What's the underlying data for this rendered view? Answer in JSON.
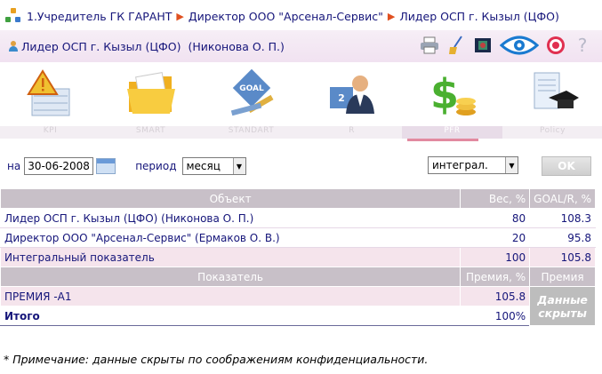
{
  "breadcrumb": {
    "items": [
      "1.Учредитель ГК ГАРАНТ",
      "Директор ООО \"Арсенал-Сервис\"",
      "Лидер ОСП г. Кызыл (ЦФО)"
    ]
  },
  "user": {
    "label": "Лидер ОСП г. Кызыл (ЦФО)  (Никонова О. П.)"
  },
  "toolbar": {
    "icons": [
      "printer-icon",
      "broom-icon",
      "film-icon",
      "eye-icon",
      "target-icon",
      "help-icon"
    ],
    "help_label": "?"
  },
  "modules": [
    {
      "icon": "kpi-warning-icon",
      "label": "KPI"
    },
    {
      "icon": "folder-icon",
      "label": "SMART"
    },
    {
      "icon": "goal-diamond-icon",
      "label": "STANDART"
    },
    {
      "icon": "user-card-icon",
      "label": "R"
    },
    {
      "icon": "dollar-coins-icon",
      "label": "PFR"
    },
    {
      "icon": "scroll-graduation-icon",
      "label": "Policy"
    }
  ],
  "filters": {
    "date_prefix": "на",
    "date_value": "30-06-2008",
    "period_label": "период",
    "period_value": "месяц",
    "mode_value": "интеграл.",
    "ok_label": "OK"
  },
  "table1": {
    "headers": [
      "Объект",
      "Вес, %",
      "GOAL/R, %"
    ],
    "rows": [
      {
        "name": "Лидер ОСП г. Кызыл (ЦФО) (Никонова О. П.)",
        "weight": "80",
        "goal": "108.3"
      },
      {
        "name": "Директор ООО \"Арсенал-Сервис\" (Ермаков О. В.)",
        "weight": "20",
        "goal": "95.8"
      },
      {
        "name": "Интегральный показатель",
        "weight": "100",
        "goal": "105.8"
      }
    ]
  },
  "table2": {
    "headers": [
      "Показатель",
      "Премия, %",
      "Премия"
    ],
    "rows": [
      {
        "name": "ПРЕМИЯ -А1",
        "pct": "105.8"
      },
      {
        "name": "Итого",
        "pct": "100%"
      }
    ],
    "hidden_line1": "Данные",
    "hidden_line2": "скрыты"
  },
  "note": "* Примечание: данные скрыты по соображениям конфиденциальности.",
  "colors": {
    "accent_arrow": "#e05020",
    "header_bg": "#c8c0c8",
    "row_pink": "#f5e4ec",
    "text": "#15157a",
    "active_tab": "#e28aa0"
  }
}
